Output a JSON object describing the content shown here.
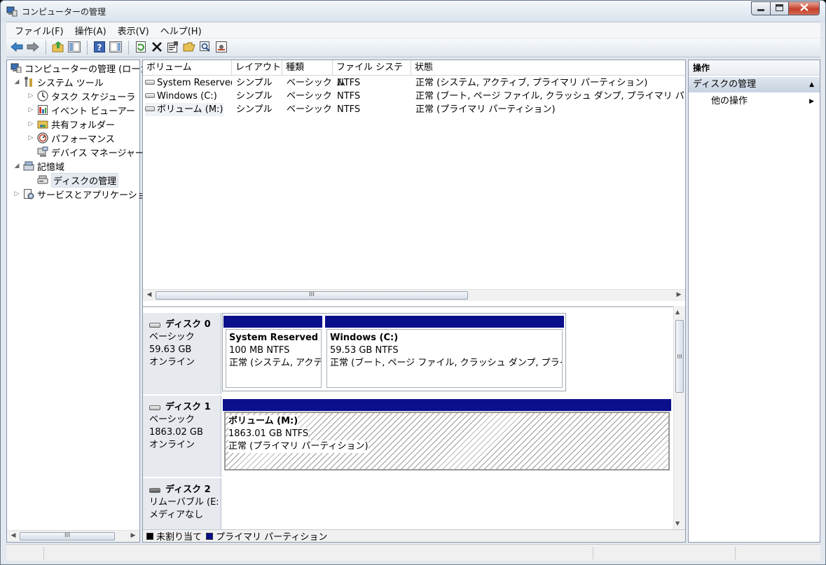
{
  "window": {
    "title": "コンピューターの管理"
  },
  "menubar": [
    {
      "label": "ファイル(F)"
    },
    {
      "label": "操作(A)"
    },
    {
      "label": "表示(V)"
    },
    {
      "label": "ヘルプ(H)"
    }
  ],
  "toolbar": [
    "back-icon",
    "forward-icon",
    "up-folder-icon",
    "show-hide-tree-icon",
    "help-icon",
    "show-hide-action-pane-icon",
    "refresh-icon",
    "delete-icon",
    "properties-icon",
    "open-folder-icon",
    "search-icon",
    "settings-icon"
  ],
  "tree": {
    "root": "コンピューターの管理 (ローカ",
    "system_tools": "システム ツール",
    "task_scheduler": "タスク スケジューラ",
    "event_viewer": "イベント ビューアー",
    "shared_folders": "共有フォルダー",
    "performance": "パフォーマンス",
    "device_manager": "デバイス マネージャー",
    "storage": "記憶域",
    "disk_management": "ディスクの管理",
    "services": "サービスとアプリケーショ",
    "scroll_thumb": "III"
  },
  "volume_list": {
    "columns": [
      "ボリューム",
      "レイアウト",
      "種類",
      "ファイル システム",
      "状態"
    ],
    "rows": [
      {
        "volume": "System Reserved",
        "layout": "シンプル",
        "type": "ベーシック",
        "fs": "NTFS",
        "status": "正常 (システム, アクティブ, プライマリ パーティション)"
      },
      {
        "volume": "Windows (C:)",
        "layout": "シンプル",
        "type": "ベーシック",
        "fs": "NTFS",
        "status": "正常 (ブート, ページ ファイル, クラッシュ ダンプ, プライマリ パーティ"
      },
      {
        "volume": "ボリューム (M:)",
        "layout": "シンプル",
        "type": "ベーシック",
        "fs": "NTFS",
        "status": "正常 (プライマリ パーティション)"
      }
    ],
    "scroll_thumb": "III"
  },
  "disks": [
    {
      "name": "ディスク 0",
      "type": "ベーシック",
      "size": "59.63 GB",
      "state": "オンライン",
      "partitions": [
        {
          "name": "System Reserved",
          "size": "100 MB NTFS",
          "status": "正常 (システム, アクテ"
        },
        {
          "name": "Windows  (C:)",
          "size": "59.53 GB NTFS",
          "status": "正常 (ブート, ページ ファイル, クラッシュ ダンプ, プライマ"
        }
      ]
    },
    {
      "name": "ディスク 1",
      "type": "ベーシック",
      "size": "1863.02 GB",
      "state": "オンライン",
      "partitions": [
        {
          "name": "ボリューム  (M:)",
          "size": "1863.01 GB NTFS",
          "status": "正常 (プライマリ パーティション)"
        }
      ]
    },
    {
      "name": "ディスク 2",
      "type": "リムーバブル (E:)",
      "size": "",
      "state": "メディアなし"
    }
  ],
  "graph_scroll_thumb": "III",
  "legend": [
    {
      "label": "未割り当て",
      "color": "#000000"
    },
    {
      "label": "プライマリ パーティション",
      "color": "#0a0f8c"
    }
  ],
  "actions": {
    "header": "操作",
    "section": "ディスクの管理",
    "item": "他の操作"
  }
}
